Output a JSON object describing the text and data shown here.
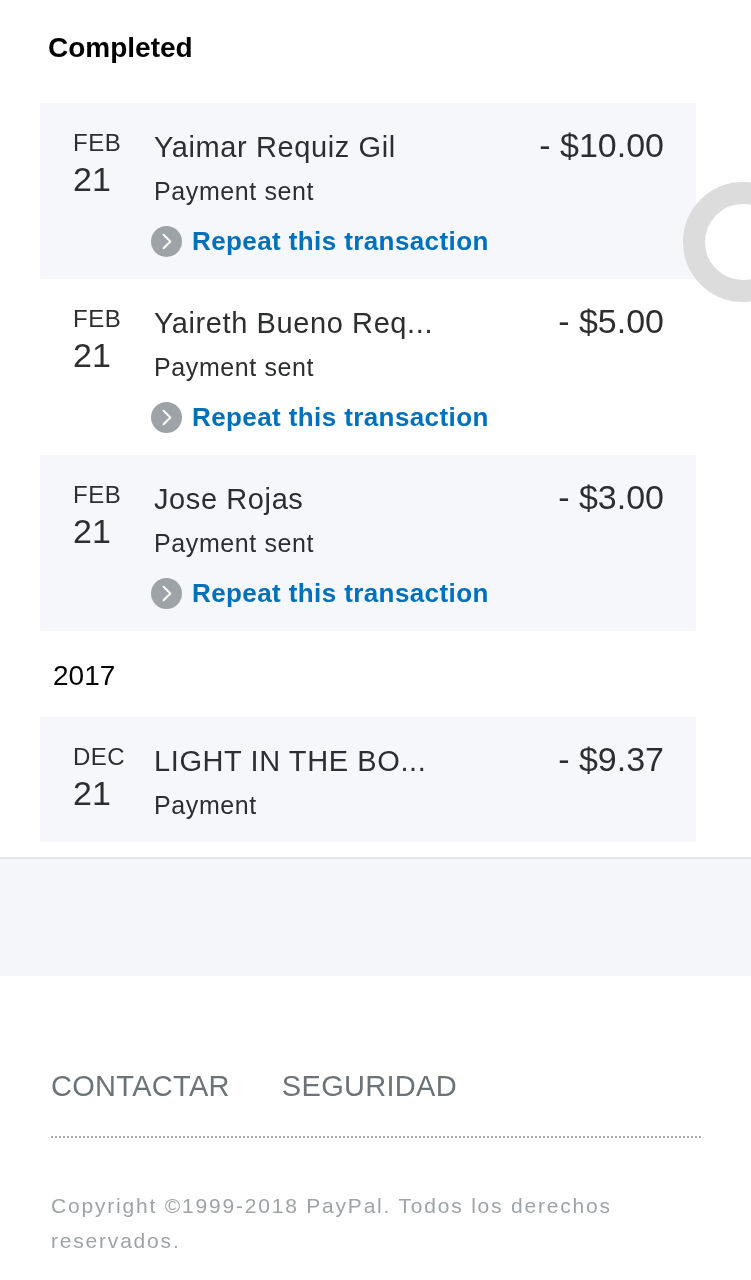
{
  "section": {
    "title": "Completed",
    "groups": [
      {
        "transactions": [
          {
            "month": "FEB",
            "day": "21",
            "name": "Yaimar Requiz Gil",
            "description": "Payment sent",
            "amount": "- $10.00",
            "action": "Repeat this transaction"
          },
          {
            "month": "FEB",
            "day": "21",
            "name": "Yaireth Bueno Req...",
            "description": "Payment sent",
            "amount": "- $5.00",
            "action": "Repeat this transaction"
          },
          {
            "month": "FEB",
            "day": "21",
            "name": "Jose Rojas",
            "description": "Payment sent",
            "amount": "- $3.00",
            "action": "Repeat this transaction"
          }
        ]
      },
      {
        "year": "2017",
        "transactions": [
          {
            "month": "DEC",
            "day": "21",
            "name": "LIGHT IN THE BO...",
            "description": "Payment",
            "amount": "- $9.37"
          }
        ]
      }
    ]
  },
  "footer": {
    "links": [
      "CONTACTAR",
      "SEGURIDAD"
    ],
    "copyright": "Copyright ©1999-2018 PayPal. Todos los derechos reservados."
  }
}
